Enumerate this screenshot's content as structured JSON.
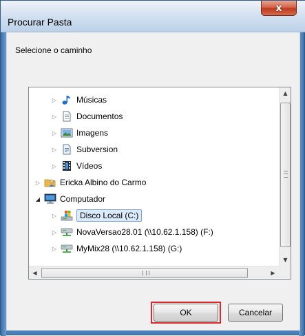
{
  "window": {
    "title": "Procurar Pasta",
    "close_label": "x"
  },
  "instruction": "Selecione o caminho",
  "tree": {
    "items": [
      {
        "label": "Músicas",
        "icon": "music-icon",
        "expanded": false
      },
      {
        "label": "Documentos",
        "icon": "document-icon",
        "expanded": false
      },
      {
        "label": "Imagens",
        "icon": "image-icon",
        "expanded": false
      },
      {
        "label": "Subversion",
        "icon": "folder-document-icon",
        "expanded": false
      },
      {
        "label": "Vídeos",
        "icon": "video-icon",
        "expanded": false
      },
      {
        "label": "Ericka Albino do Carmo",
        "icon": "user-folder-icon",
        "expanded": false
      },
      {
        "label": "Computador",
        "icon": "computer-icon",
        "expanded": true
      },
      {
        "label": "Disco Local (C:)",
        "icon": "local-disk-icon",
        "expanded": false,
        "selected": true
      },
      {
        "label": "NovaVersao28.01 (\\\\10.62.1.158) (F:)",
        "icon": "network-drive-icon",
        "expanded": false
      },
      {
        "label": "MyMix28 (\\\\10.62.1.158) (G:)",
        "icon": "network-drive-icon",
        "expanded": false
      }
    ]
  },
  "buttons": {
    "ok": "OK",
    "cancel": "Cancelar"
  },
  "colors": {
    "highlight_border": "#e0262a",
    "selection_fill": "#dcebfc"
  }
}
